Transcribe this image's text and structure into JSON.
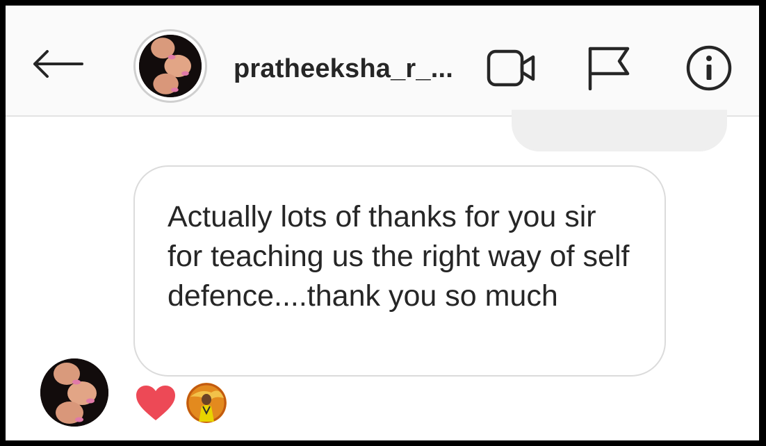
{
  "header": {
    "back_icon": "arrow-left-icon",
    "username": "pratheeksha_r_...",
    "actions": [
      {
        "name": "video-call-button",
        "icon": "video-camera-icon"
      },
      {
        "name": "report-button",
        "icon": "flag-icon"
      },
      {
        "name": "info-button",
        "icon": "info-icon"
      }
    ]
  },
  "conversation": {
    "message": {
      "text": "Actually lots of thanks for you sir for teaching us the right way of self defence....thank you so much"
    },
    "reactions": {
      "emoji_icon": "heart-icon",
      "emoji_color": "#ed4956"
    }
  },
  "colors": {
    "header_bg": "#fafafa",
    "text": "#262626",
    "bubble_border": "#dbdbdb",
    "received_bubble_bg": "#efefef"
  }
}
